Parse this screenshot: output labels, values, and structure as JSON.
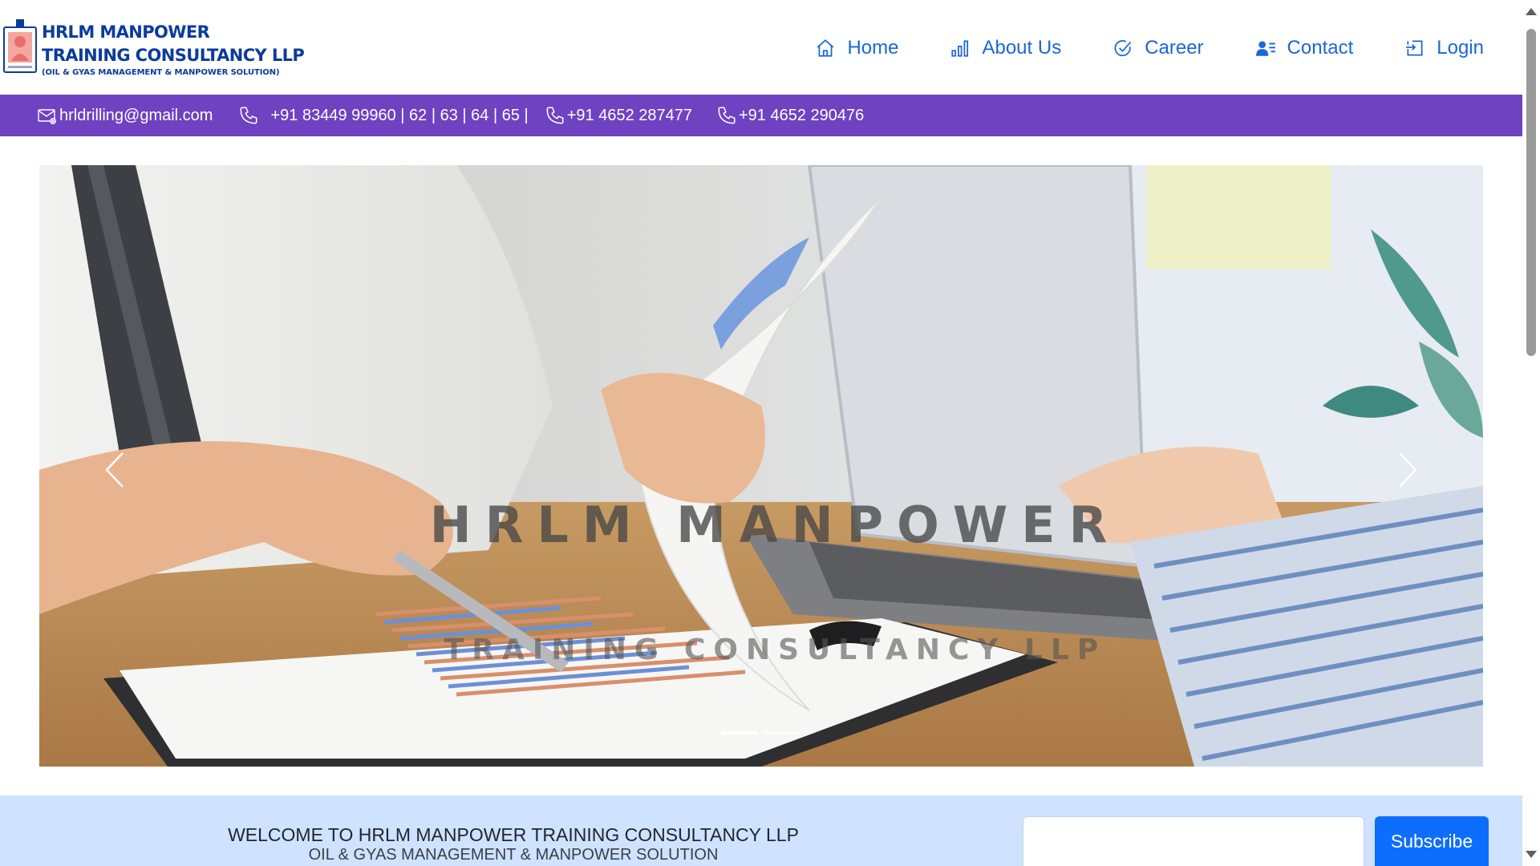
{
  "brand": {
    "line1": "HRLM MANPOWER",
    "line2": "TRAINING CONSULTANCY LLP",
    "line3": "(OIL & GYAS MANAGEMENT & MANPOWER SOLUTION)",
    "color": "#0b3c9c"
  },
  "nav": {
    "items": [
      {
        "label": "Home",
        "icon": "home-icon"
      },
      {
        "label": "About Us",
        "icon": "bar-chart-icon"
      },
      {
        "label": "Career",
        "icon": "check-circle-icon"
      },
      {
        "label": "Contact",
        "icon": "user-list-icon"
      },
      {
        "label": "Login",
        "icon": "login-icon"
      }
    ],
    "color": "#1a66d9"
  },
  "contact_bar": {
    "background": "#6f42c1",
    "email": "hrldrilling@gmail.com",
    "phone1": "+91 83449 99960 | 62 | 63 | 64 | 65 |",
    "phone2": "+91 4652 287477",
    "phone3": "+91 4652 290476"
  },
  "hero": {
    "title": "HRLM MANPOWER",
    "subtitle": "TRAINING CONSULTANCY LLP",
    "slide_count": 2,
    "active_slide": 1
  },
  "welcome": {
    "title": "WELCOME TO HRLM MANPOWER TRAINING CONSULTANCY LLP",
    "subtitle": "OIL & GYAS MANAGEMENT & MANPOWER SOLUTION",
    "background": "#cfe2ff"
  },
  "subscribe": {
    "input_value": "",
    "button_label": "Subscribe",
    "button_color": "#0d6efd"
  }
}
